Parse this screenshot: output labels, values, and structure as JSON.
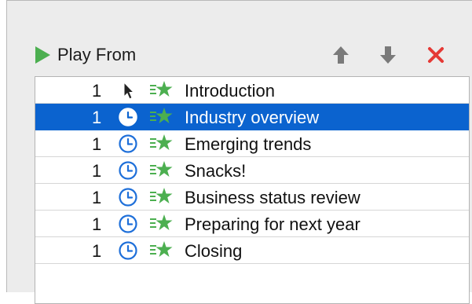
{
  "toolbar": {
    "play_from_label": "Play From",
    "icons": [
      "play-icon",
      "move-up-icon",
      "move-down-icon",
      "delete-icon"
    ]
  },
  "animation_list": {
    "selected_index": 1,
    "rows": [
      {
        "order": "1",
        "trigger": "on-click",
        "effect": "entrance",
        "title": "Introduction"
      },
      {
        "order": "1",
        "trigger": "after-previous",
        "effect": "entrance",
        "title": "Industry overview"
      },
      {
        "order": "1",
        "trigger": "after-previous",
        "effect": "entrance",
        "title": "Emerging trends"
      },
      {
        "order": "1",
        "trigger": "after-previous",
        "effect": "entrance",
        "title": "Snacks!"
      },
      {
        "order": "1",
        "trigger": "after-previous",
        "effect": "entrance",
        "title": "Business status review"
      },
      {
        "order": "1",
        "trigger": "after-previous",
        "effect": "entrance",
        "title": "Preparing for next year"
      },
      {
        "order": "1",
        "trigger": "after-previous",
        "effect": "entrance",
        "title": "Closing"
      }
    ]
  },
  "colors": {
    "play_green": "#4caf50",
    "arrow_gray": "#7a7a7a",
    "delete_red": "#e53935",
    "selection_blue": "#0b63cf",
    "clock_blue": "#1e6fd9",
    "star_green": "#4caf50"
  }
}
